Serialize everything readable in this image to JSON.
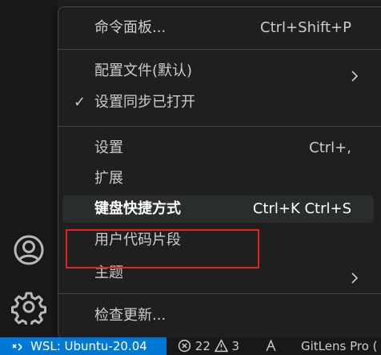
{
  "menu": {
    "command_palette": {
      "label": "命令面板...",
      "keys": "Ctrl+Shift+P"
    },
    "profile": {
      "label": "配置文件(默认)"
    },
    "settings_sync": {
      "check": "✓",
      "label": "设置同步已打开"
    },
    "settings": {
      "label": "设置",
      "keys": "Ctrl+,"
    },
    "extensions": {
      "label": "扩展"
    },
    "keyboard_shortcuts": {
      "label": "键盘快捷方式",
      "keys": "Ctrl+K Ctrl+S"
    },
    "user_snippets": {
      "label": "用户代码片段"
    },
    "themes": {
      "label": "主题"
    },
    "check_updates": {
      "label": "检查更新..."
    }
  },
  "status_bar": {
    "remote": "WSL: Ubuntu-20.04",
    "errors": "22",
    "warnings": "3",
    "gitlens": "GitLens Pro (",
    "accent_color": "#0078d4"
  },
  "icons": [
    "account-icon",
    "gear-icon",
    "check-icon",
    "chevron-right-icon",
    "remote-icon",
    "error-icon",
    "warning-icon"
  ],
  "annotation_color": "#e02424"
}
